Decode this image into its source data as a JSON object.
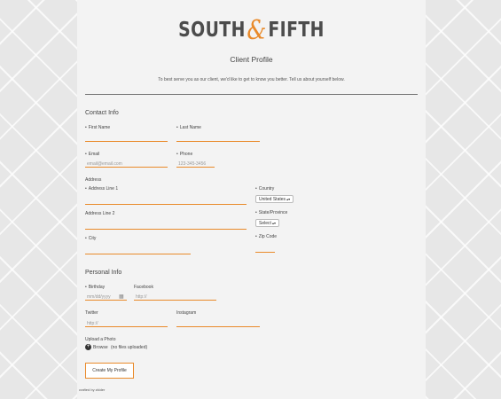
{
  "brand": {
    "left": "SOUTH",
    "amp": "&",
    "right": "FIFTH"
  },
  "page_title": "Client Profile",
  "intro": "To best serve you as our client, we'd like to get to know you better. Tell us about yourself below.",
  "contact": {
    "heading": "Contact Info",
    "first_name_label": "First Name",
    "last_name_label": "Last Name",
    "email_label": "Email",
    "email_placeholder": "email@email.com",
    "phone_label": "Phone",
    "phone_placeholder": "123-345-3456",
    "address_heading": "Address",
    "address1_label": "Address Line 1",
    "address2_label": "Address Line 2",
    "city_label": "City",
    "country_label": "Country",
    "country_value": "United States",
    "state_label": "State/Province",
    "state_value": "Select",
    "zip_label": "Zip Code"
  },
  "personal": {
    "heading": "Personal Info",
    "birthday_label": "Birthday",
    "birthday_placeholder": "mm/dd/yyyy",
    "facebook_label": "Facebook",
    "facebook_placeholder": "http://",
    "twitter_label": "Twitter",
    "twitter_placeholder": "http://",
    "instagram_label": "Instagram",
    "instagram_placeholder": "",
    "upload_label": "Upload a Photo",
    "browse_label": "Browse",
    "no_files": "(no files uploaded)"
  },
  "submit_label": "Create My Profile",
  "credit": "crafted by zkider",
  "colors": {
    "accent": "#e98a2a",
    "card": "#f3f3f3",
    "background": "#e7e7e7"
  },
  "icons": {
    "calendar": "calendar-icon",
    "upload": "upload-icon"
  }
}
